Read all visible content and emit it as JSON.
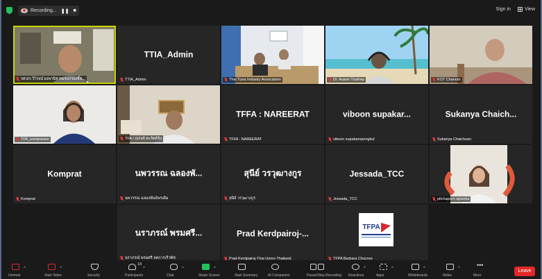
{
  "topbar": {
    "recording_label": "Recording...",
    "pause_glyph": "❚❚",
    "stop_glyph": "■",
    "signin_label": "Sign in",
    "view_label": "View"
  },
  "tiles": [
    {
      "name": "",
      "label": "รศ.ดร.วิโรจน์ ยงพานิช ขนรบกรองจิ๊ช..."
    },
    {
      "name": "TTIA_Admin",
      "label": "TTIA_Admin"
    },
    {
      "name": "",
      "label": "Thai Tuna Industry Association"
    },
    {
      "name": "",
      "label": "Dr. Asarin Tirathep"
    },
    {
      "name": "",
      "label": "KOT Chanutn"
    },
    {
      "name": "",
      "label": "TFA_sompranee"
    },
    {
      "name": "",
      "label": "TFA / ณรงค์ ตะรัตต์รัถ"
    },
    {
      "name": "TFFA : NAREERAT",
      "label": "TFFA : NAREERAT"
    },
    {
      "name": "viboon  supakar...",
      "label": "viboon supakarnpongkul"
    },
    {
      "name": "Sukanya  Chaich...",
      "label": "Sukanya Chaichuen"
    },
    {
      "name": "Komprat",
      "label": "Komprat"
    },
    {
      "name": "นพวรรณ  ฉลองพั...",
      "label": "นพวรรณ ฉลองพันธ์พรเดิม"
    },
    {
      "name": "สุนีย์  วรวุฒางกูร",
      "label": "สุนีย์ วรวุฒางกูร"
    },
    {
      "name": "Jessada_TCC",
      "label": "Jessada_TCC"
    },
    {
      "name": "",
      "label": "pitchaporn apiseka"
    },
    {
      "name": "นราภรณ์  พรมศรี...",
      "label": "นราภรณ์ พรมศรี ลคการเร็วพิช"
    },
    {
      "name": "Prad  Kerdpairoj-...",
      "label": "Prad Kerdpairoj-Thai Union-Thailand"
    },
    {
      "name": "",
      "label": "TFPA Barbara Chucree"
    }
  ],
  "logo_text": "TFPA",
  "toolbar": {
    "items": [
      {
        "label": "Unmute",
        "icon": "microphone-muted-icon"
      },
      {
        "label": "Start Video",
        "icon": "video-off-icon"
      },
      {
        "label": "Security",
        "icon": "shield-icon"
      },
      {
        "label": "Participants",
        "icon": "participants-icon",
        "count": "18"
      },
      {
        "label": "Chat",
        "icon": "chat-icon"
      },
      {
        "label": "Share Screen",
        "icon": "share-screen-icon"
      },
      {
        "label": "Start Summary",
        "icon": "summary-icon"
      },
      {
        "label": "AI Companion",
        "icon": "ai-companion-icon"
      },
      {
        "label": "Pause/Stop Recording",
        "icon": "pause-stop-icon"
      },
      {
        "label": "Reactions",
        "icon": "reactions-icon"
      },
      {
        "label": "Apps",
        "icon": "apps-icon"
      },
      {
        "label": "Whiteboards",
        "icon": "whiteboard-icon"
      },
      {
        "label": "Notes",
        "icon": "notes-icon"
      },
      {
        "label": "More",
        "icon": "more-icon"
      }
    ],
    "leave_label": "Leave"
  },
  "colors": {
    "active_speaker": "#c7d400",
    "share_screen": "#23c15c",
    "leave": "#e02828"
  }
}
